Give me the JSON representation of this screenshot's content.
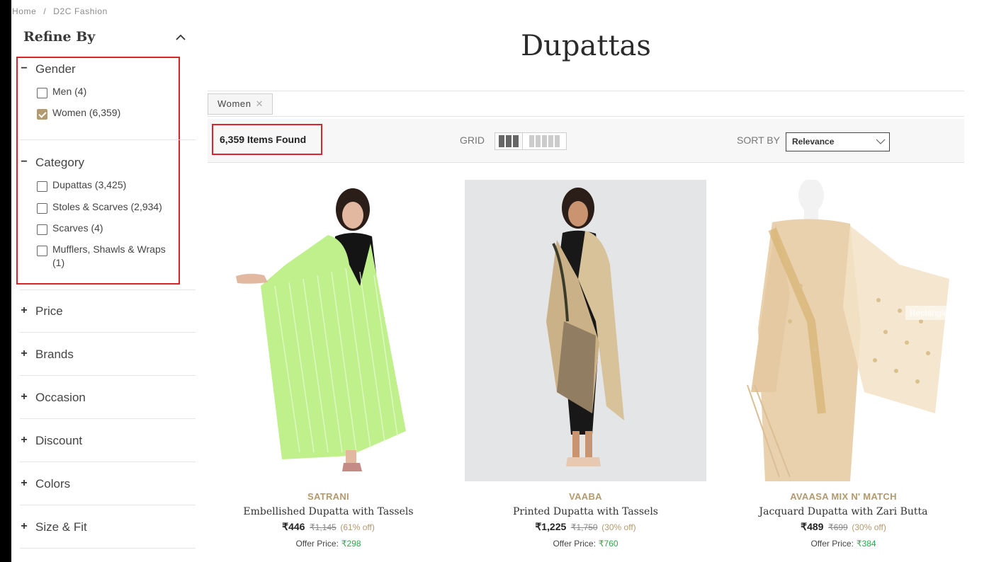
{
  "breadcrumb": [
    "Home",
    "/",
    "D2C Fashion"
  ],
  "sidebar": {
    "title": "Refine By",
    "gender": {
      "title": "Gender",
      "options": [
        {
          "label": "Men (4)",
          "checked": false
        },
        {
          "label": "Women (6,359)",
          "checked": true
        }
      ]
    },
    "category": {
      "title": "Category",
      "options": [
        {
          "label": "Dupattas (3,425)",
          "checked": false
        },
        {
          "label": "Stoles & Scarves (2,934)",
          "checked": false
        },
        {
          "label": "Scarves (4)",
          "checked": false
        },
        {
          "label": "Mufflers, Shawls & Wraps (1)",
          "checked": false
        }
      ]
    },
    "collapsed": [
      "Price",
      "Brands",
      "Occasion",
      "Discount",
      "Colors",
      "Size & Fit"
    ]
  },
  "main": {
    "title": "Dupattas",
    "chip": {
      "label": "Women",
      "remove": "✕"
    },
    "items_found": "6,359 Items Found",
    "grid_label": "GRID",
    "sort_label": "SORT BY",
    "sort_value": "Relevance"
  },
  "products": [
    {
      "brand": "SATRANI",
      "name": "Embellished Dupatta with Tassels",
      "price": "₹446",
      "mrp": "₹1,145",
      "discount": "(61% off)",
      "offer_label": "Offer Price:",
      "offer_price": "₹298",
      "image_bg": "#ffffff"
    },
    {
      "brand": "VAABA",
      "name": "Printed Dupatta with Tassels",
      "price": "₹1,225",
      "mrp": "₹1,750",
      "discount": "(30% off)",
      "offer_label": "Offer Price:",
      "offer_price": "₹760",
      "image_bg": "#e4e5e7"
    },
    {
      "brand": "AVAASA MIX N' MATCH",
      "name": "Jacquard Dupatta with Zari Butta",
      "price": "₹489",
      "mrp": "₹699",
      "discount": "(30% off)",
      "offer_label": "Offer Price:",
      "offer_price": "₹384",
      "image_bg": "#ffffff",
      "watermark": "Rectangle"
    }
  ],
  "colors": {
    "accent_gold": "#b49a70",
    "highlight_red": "#d9232d",
    "offer_green": "#2ea84b"
  }
}
